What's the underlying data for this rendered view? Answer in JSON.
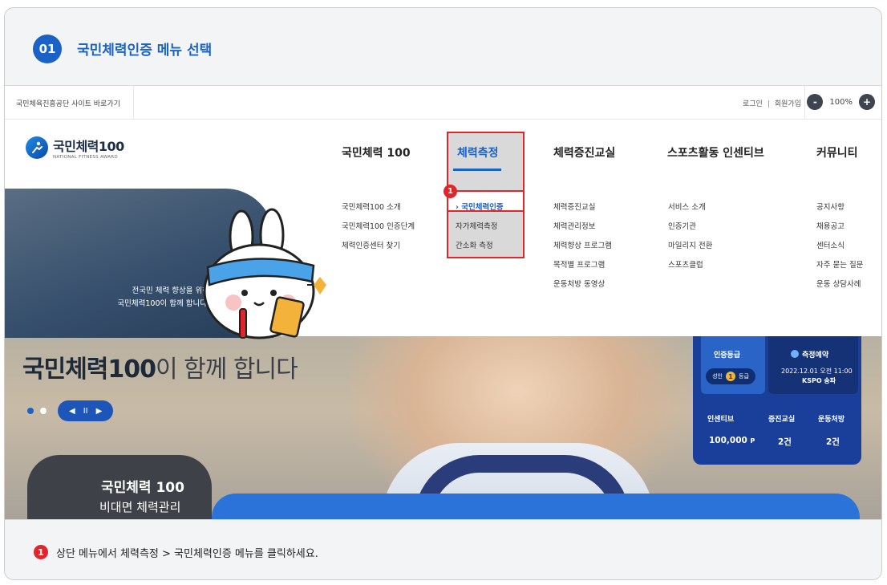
{
  "step": {
    "number": "01",
    "title": "국민체력인증 메뉴 선택"
  },
  "utility": {
    "site_link": "국민체육진흥공단 사이트 바로가기",
    "login": "로그인",
    "separator": "|",
    "signup": "회원가입",
    "zoom_minus": "-",
    "zoom_level": "100%",
    "zoom_plus": "+"
  },
  "logo": {
    "title": "국민체력100",
    "subtitle": "NATIONAL FITNESS AWARD"
  },
  "gnb": [
    {
      "label": "국민체력 100",
      "sub": [
        "국민체력100 소개",
        "국민체력100 인증단계",
        "체력인증센터 찾기"
      ]
    },
    {
      "label": "체력측정",
      "sub": [
        "› 국민체력인증",
        "자가체력측정",
        "간소화 측정"
      ]
    },
    {
      "label": "체력증진교실",
      "sub": [
        "체력증진교실",
        "체력관리정보",
        "체력향상 프로그램",
        "목적별 프로그램",
        "운동처방 동영상"
      ]
    },
    {
      "label": "스포츠활동 인센티브",
      "sub": [
        "서비스 소개",
        "인증기관",
        "마일리지 전환",
        "스포츠클럽"
      ]
    },
    {
      "label": "커뮤니티",
      "sub": [
        "공지사항",
        "채용공고",
        "센터소식",
        "자주 묻는 질문",
        "운동 상담사례"
      ]
    }
  ],
  "annotation_badge": "1",
  "side_panel": {
    "line1": "전국민 체력 향상을 위해",
    "line2": "국민체력100이 함께 합니다."
  },
  "hero": {
    "title_bold": "국민체력100",
    "title_light": "이 함께 합니다",
    "controls": {
      "prev": "◀",
      "pause": "II",
      "next": "▶"
    },
    "card_title": "국민체력 100",
    "card_sub": "비대면 체력관리"
  },
  "dashboard": {
    "cert_label": "인증등급",
    "cert_grade_prefix": "성인",
    "cert_grade_num": "1",
    "cert_grade_suffix": "등급",
    "reservation_label": "측정예약",
    "reservation_date": "2022.12.01 오전 11:00",
    "reservation_place": "KSPO 송파",
    "stats": [
      {
        "label": "인센티브",
        "value": "100,000",
        "unit": "P"
      },
      {
        "label": "증진교실",
        "value": "2건"
      },
      {
        "label": "운동처방",
        "value": "2건"
      }
    ]
  },
  "instruction": {
    "badge": "1",
    "text": "상단 메뉴에서 체력측정 > 국민체력인증 메뉴를 클릭하세요."
  },
  "colors": {
    "accent": "#1b62c7",
    "highlight": "#e0262b",
    "dark": "#3e4148"
  }
}
